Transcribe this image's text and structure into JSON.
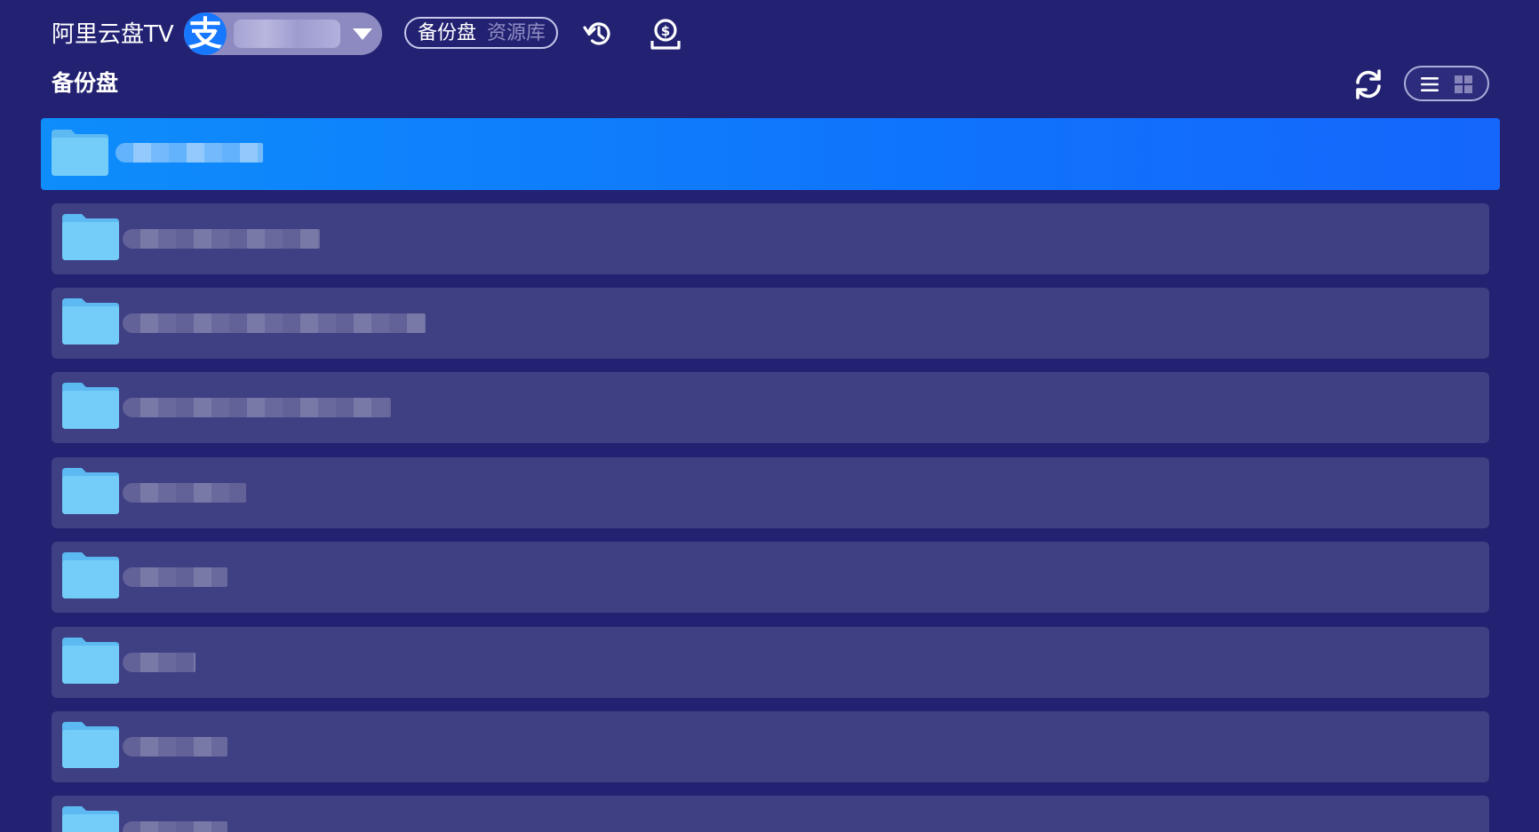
{
  "header": {
    "app_title": "阿里云盘TV",
    "account_icon": "alipay-icon",
    "account_icon_glyph": "支",
    "account_name": "",
    "tabs": [
      {
        "label": "备份盘",
        "active": true
      },
      {
        "label": "资源库",
        "active": false
      }
    ],
    "history_icon": "history-icon",
    "sponsor_icon": "sponsor-icon"
  },
  "section": {
    "title": "备份盘",
    "refresh_icon": "refresh-icon",
    "view_modes": [
      {
        "icon": "list-view-icon",
        "active": true
      },
      {
        "icon": "grid-view-icon",
        "active": false
      }
    ]
  },
  "files": [
    {
      "name": "",
      "type": "folder",
      "selected": true
    },
    {
      "name": "",
      "type": "folder",
      "selected": false
    },
    {
      "name": "",
      "type": "folder",
      "selected": false
    },
    {
      "name": "",
      "type": "folder",
      "selected": false
    },
    {
      "name": "",
      "type": "folder",
      "selected": false
    },
    {
      "name": "",
      "type": "folder",
      "selected": false
    },
    {
      "name": "",
      "type": "folder",
      "selected": false
    },
    {
      "name": "",
      "type": "folder",
      "selected": false
    },
    {
      "name": "",
      "type": "folder",
      "selected": false
    }
  ],
  "colors": {
    "background": "#232272",
    "row": "#3f3f83",
    "selected_row": "#0f74fc",
    "folder": "#67c6f6",
    "alipay_blue": "#1677ff"
  }
}
